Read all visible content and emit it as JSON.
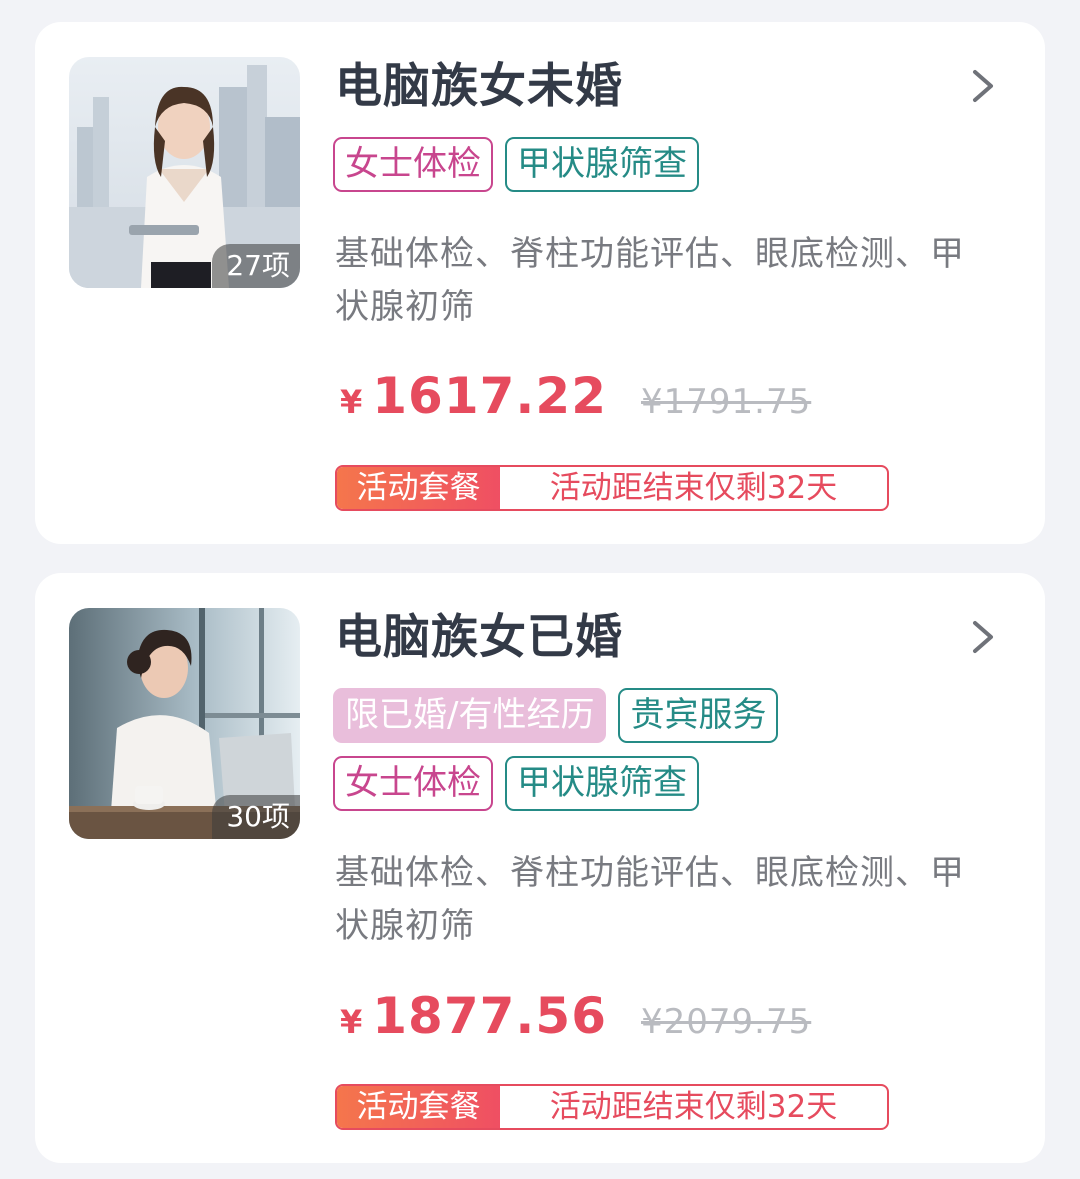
{
  "packages": [
    {
      "title": "电脑族女未婚",
      "item_count": "27项",
      "tags_row1": [
        "女士体检",
        "甲状腺筛查"
      ],
      "description": "基础体检、脊柱功能评估、眼底检测、甲状腺初筛",
      "currency": "¥",
      "price": "1617.22",
      "original_price": "¥1791.75",
      "promo_label": "活动套餐",
      "promo_text": "活动距结束仅剩32天"
    },
    {
      "title": "电脑族女已婚",
      "item_count": "30项",
      "tags_row1": [
        "限已婚/有性经历",
        "贵宾服务"
      ],
      "tags_row2": [
        "女士体检",
        "甲状腺筛查"
      ],
      "description": "基础体检、脊柱功能评估、眼底检测、甲状腺初筛",
      "currency": "¥",
      "price": "1877.56",
      "original_price": "¥2079.75",
      "promo_label": "活动套餐",
      "promo_text": "活动距结束仅剩32天"
    }
  ],
  "icons": {
    "chevron": "chevron-right-icon"
  },
  "colors": {
    "price": "#e64b5e",
    "tag_pink": "#c8468e",
    "tag_teal": "#258b86",
    "tag_pink_fill": "#e9bedb",
    "promo_gradient_start": "#f5764c",
    "promo_gradient_end": "#ef4f63",
    "title": "#333a47",
    "description": "#787a80",
    "original_price": "#b9bbc0"
  }
}
